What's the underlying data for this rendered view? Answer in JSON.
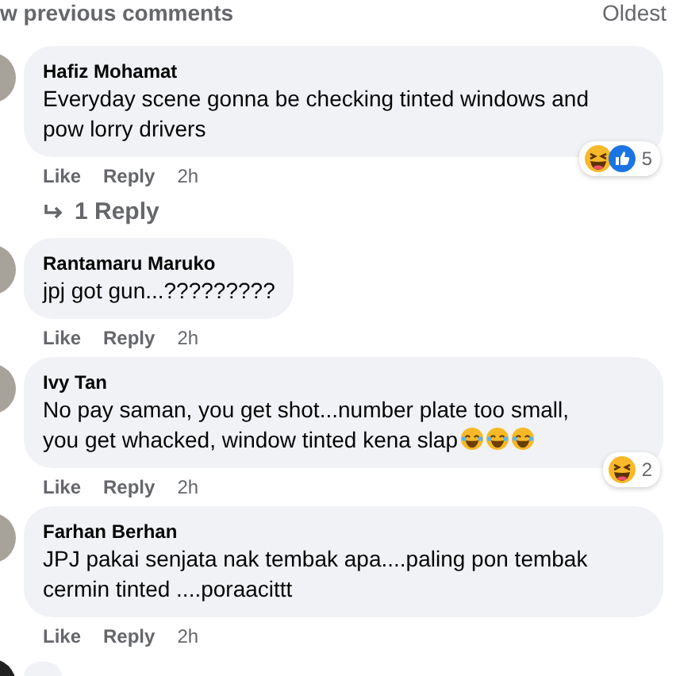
{
  "header": {
    "view_previous": "w previous comments",
    "sort": "Oldest"
  },
  "comments": [
    {
      "kind": "full",
      "author": "Hafiz Mohamat",
      "text": "Everyday scene gonna be checking tinted windows and pow lorry drivers",
      "reactions": [
        {
          "kind": "haha"
        },
        {
          "kind": "like"
        }
      ],
      "reaction_count": "5",
      "actions": [
        "Like",
        "Reply",
        "2h"
      ],
      "replies": "1 Reply"
    },
    {
      "kind": "full",
      "author": "Rantamaru Maruko",
      "text": "jpj got gun...?????????",
      "actions": [
        "Like",
        "Reply",
        "2h"
      ]
    },
    {
      "kind": "full",
      "author": "Ivy Tan",
      "text": "No pay saman, you get shot...number plate too small, you get whacked, window tinted kena slap",
      "emojis": [
        {
          "kind": "rofl"
        },
        {
          "kind": "rofl"
        },
        {
          "kind": "rofl"
        }
      ],
      "reactions": [
        {
          "kind": "haha"
        }
      ],
      "reaction_count": "2",
      "actions": [
        "Like",
        "Reply",
        "2h"
      ]
    },
    {
      "kind": "full",
      "author": "Farhan Berhan",
      "text": "JPJ pakai senjata nak tembak apa....paling pon tembak cermin tinted ....poraacittt",
      "actions": [
        "Like",
        "Reply",
        "2h"
      ]
    },
    {
      "kind": "cut"
    }
  ]
}
